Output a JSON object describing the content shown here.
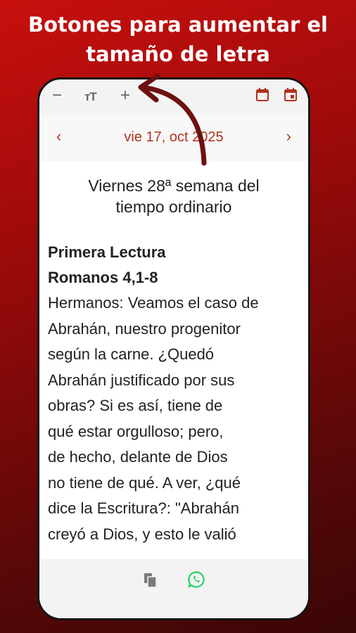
{
  "banner": {
    "line1": "Botones para aumentar el",
    "line2": "tamaño de letra"
  },
  "toolbar": {
    "decrease_glyph": "−",
    "font_size_glyph": "ᴛT",
    "increase_glyph": "+"
  },
  "date_nav": {
    "prev": "‹",
    "date": "vie 17, oct 2025",
    "next": "›"
  },
  "day": {
    "line1": "Viernes 28ª semana del",
    "line2": "tiempo ordinario"
  },
  "reading": {
    "heading": "Primera Lectura",
    "reference": "Romanos 4,1-8",
    "lines": [
      "Hermanos: Veamos el caso de",
      "Abrahán, nuestro progenitor",
      "según la carne. ¿Quedó",
      "Abrahán justificado por sus",
      "obras? Si es así, tiene de",
      "qué estar orgulloso; pero,",
      "de hecho, delante de Dios",
      "no tiene de qué. A ver, ¿qué",
      "dice la Escritura?: \"Abrahán",
      "creyó a Dios, y esto le valió"
    ]
  },
  "colors": {
    "accent": "#b0331f",
    "arrow": "#6e1010",
    "whatsapp": "#25d366",
    "bg_top": "#c8100e",
    "bg_bottom": "#3a0606"
  },
  "icons": [
    "minus-icon",
    "text-size-icon",
    "plus-icon",
    "calendar-icon",
    "calendar-today-icon",
    "copy-icon",
    "whatsapp-icon"
  ]
}
